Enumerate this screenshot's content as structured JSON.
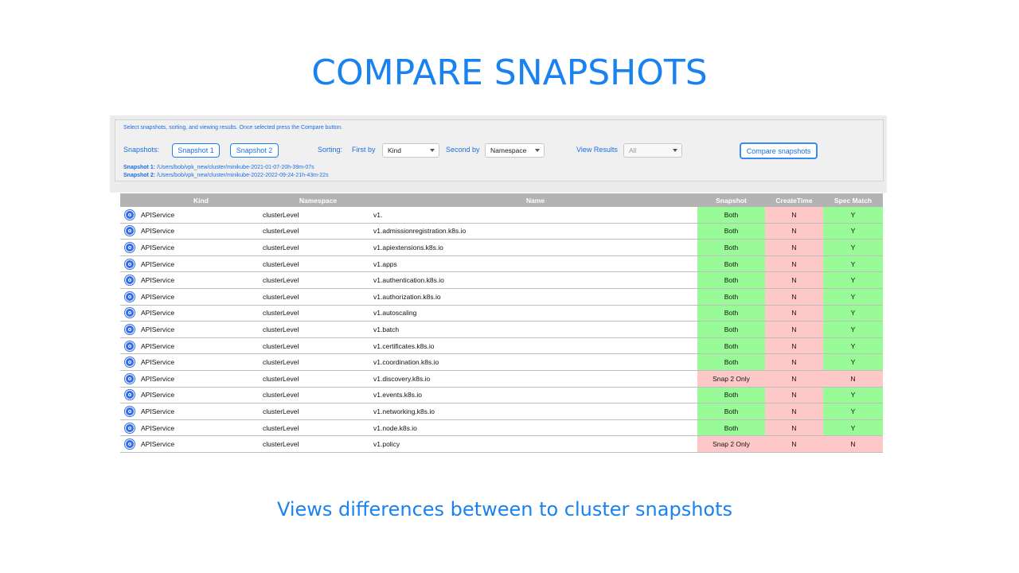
{
  "title": "COMPARE SNAPSHOTS",
  "subtitle": "Views differences between to cluster snapshots",
  "controls": {
    "instructions": "Select snapshots, sorting, and viewing results. Once selected press the Compare button.",
    "snapshots_label": "Snapshots:",
    "snapshot1_button": "Snapshot 1",
    "snapshot2_button": "Snapshot 2",
    "sorting_label": "Sorting:",
    "first_by_label": "First by",
    "first_by_value": "Kind",
    "second_by_label": "Second by",
    "second_by_value": "Namespace",
    "view_results_label": "View Results",
    "view_results_value": "All",
    "compare_button": "Compare snapshots",
    "snapshot1_path_label": "Snapshot 1:",
    "snapshot1_path": "/Users/bob/vpk_new/cluster/minikube-2021-01-07-20h-39m-07s",
    "snapshot2_path_label": "Snapshot 2:",
    "snapshot2_path": "/Users/bob/vpk_new/cluster/minikube-2022-2022-09-24-21h-43m-22s"
  },
  "table": {
    "headers": [
      "Kind",
      "Namespace",
      "Name",
      "Snapshot",
      "CreateTime",
      "Spec Match"
    ],
    "rows": [
      {
        "kind": "APIService",
        "namespace": "clusterLevel",
        "name": "v1.",
        "snapshot": "Both",
        "createtime": "N",
        "spec": "Y"
      },
      {
        "kind": "APIService",
        "namespace": "clusterLevel",
        "name": "v1.admissionregistration.k8s.io",
        "snapshot": "Both",
        "createtime": "N",
        "spec": "Y"
      },
      {
        "kind": "APIService",
        "namespace": "clusterLevel",
        "name": "v1.apiextensions.k8s.io",
        "snapshot": "Both",
        "createtime": "N",
        "spec": "Y"
      },
      {
        "kind": "APIService",
        "namespace": "clusterLevel",
        "name": "v1.apps",
        "snapshot": "Both",
        "createtime": "N",
        "spec": "Y"
      },
      {
        "kind": "APIService",
        "namespace": "clusterLevel",
        "name": "v1.authentication.k8s.io",
        "snapshot": "Both",
        "createtime": "N",
        "spec": "Y"
      },
      {
        "kind": "APIService",
        "namespace": "clusterLevel",
        "name": "v1.authorization.k8s.io",
        "snapshot": "Both",
        "createtime": "N",
        "spec": "Y"
      },
      {
        "kind": "APIService",
        "namespace": "clusterLevel",
        "name": "v1.autoscaling",
        "snapshot": "Both",
        "createtime": "N",
        "spec": "Y"
      },
      {
        "kind": "APIService",
        "namespace": "clusterLevel",
        "name": "v1.batch",
        "snapshot": "Both",
        "createtime": "N",
        "spec": "Y"
      },
      {
        "kind": "APIService",
        "namespace": "clusterLevel",
        "name": "v1.certificates.k8s.io",
        "snapshot": "Both",
        "createtime": "N",
        "spec": "Y"
      },
      {
        "kind": "APIService",
        "namespace": "clusterLevel",
        "name": "v1.coordination.k8s.io",
        "snapshot": "Both",
        "createtime": "N",
        "spec": "Y"
      },
      {
        "kind": "APIService",
        "namespace": "clusterLevel",
        "name": "v1.discovery.k8s.io",
        "snapshot": "Snap 2 Only",
        "createtime": "N",
        "spec": "N"
      },
      {
        "kind": "APIService",
        "namespace": "clusterLevel",
        "name": "v1.events.k8s.io",
        "snapshot": "Both",
        "createtime": "N",
        "spec": "Y"
      },
      {
        "kind": "APIService",
        "namespace": "clusterLevel",
        "name": "v1.networking.k8s.io",
        "snapshot": "Both",
        "createtime": "N",
        "spec": "Y"
      },
      {
        "kind": "APIService",
        "namespace": "clusterLevel",
        "name": "v1.node.k8s.io",
        "snapshot": "Both",
        "createtime": "N",
        "spec": "Y"
      },
      {
        "kind": "APIService",
        "namespace": "clusterLevel",
        "name": "v1.policy",
        "snapshot": "Snap 2 Only",
        "createtime": "N",
        "spec": "N"
      }
    ]
  },
  "colors": {
    "accent": "#1a82f0",
    "match": "#98fb98",
    "mismatch": "#ffc8c8",
    "header": "#b3b3b3",
    "k8s_icon": "#326ce5"
  },
  "icons": {
    "row_icon": "kubernetes-icon",
    "dropdown": "chevron-down-icon"
  }
}
